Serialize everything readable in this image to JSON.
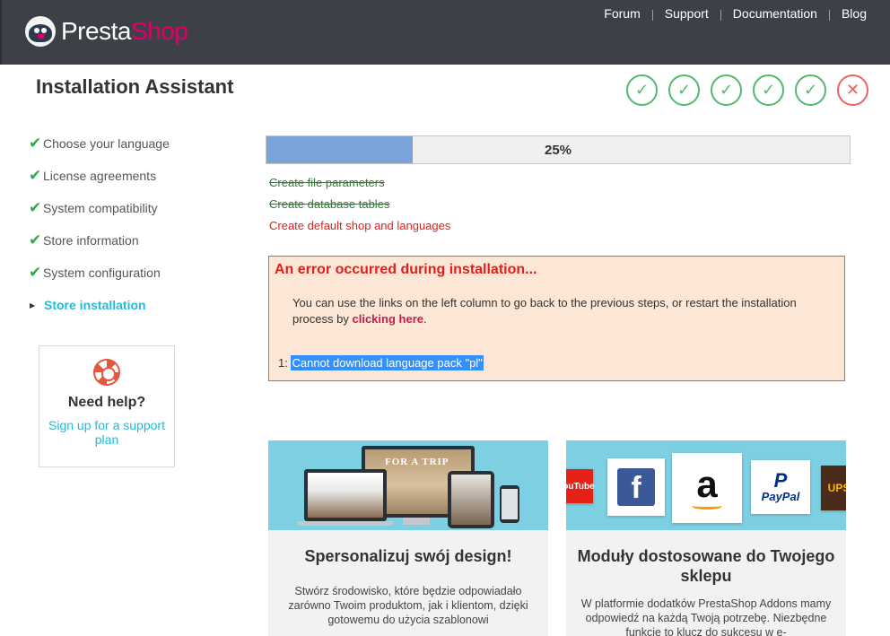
{
  "header": {
    "logo_presta": "Presta",
    "logo_shop": "Shop",
    "nav": [
      "Forum",
      "Support",
      "Documentation",
      "Blog"
    ]
  },
  "title": "Installation Assistant",
  "steps_status": [
    "done",
    "done",
    "done",
    "done",
    "done",
    "error"
  ],
  "sidebar": {
    "items": [
      {
        "label": "Choose your language",
        "state": "done"
      },
      {
        "label": "License agreements",
        "state": "done"
      },
      {
        "label": "System compatibility",
        "state": "done"
      },
      {
        "label": "Store information",
        "state": "done"
      },
      {
        "label": "System configuration",
        "state": "done"
      },
      {
        "label": "Store installation",
        "state": "active"
      }
    ]
  },
  "help": {
    "title": "Need help?",
    "link": "Sign up for a support plan"
  },
  "progress": {
    "percent": 25,
    "label": "25%"
  },
  "tasks": [
    {
      "label": "Create file parameters",
      "state": "done"
    },
    {
      "label": "Create database tables",
      "state": "done"
    },
    {
      "label": "Create default shop and languages",
      "state": "failed"
    }
  ],
  "error": {
    "title": "An error occurred during installation...",
    "message_before": "You can use the links on the left column to go back to the previous steps, or restart the installation process by",
    "link": "clicking here",
    "message_after": ".",
    "items": [
      {
        "number": "1:",
        "text": "Cannot download language pack \"pl\""
      }
    ]
  },
  "cards": [
    {
      "image_text": "FOR A TRIP",
      "title": "Spersonalizuj swój design!",
      "text": "Stwórz środowisko, które będzie odpowiadało zarówno Twoim produktom, jak i klientom, dzięki gotowemu do użycia szablonowi"
    },
    {
      "brands": [
        "YouTube",
        "Facebook",
        "Amazon",
        "PayPal",
        "UPS"
      ],
      "title": "Moduły dostosowane do Twojego sklepu",
      "text": "W platformie dodatków PrestaShop Addons mamy odpowiedź na każdą Twoją potrzebę. Niezbędne funkcje to klucz do sukcesu w e-"
    }
  ],
  "colors": {
    "header_bg": "#3d4047",
    "brand_pink": "#df0067",
    "success": "#4fba6f",
    "error": "#e0201c",
    "link": "#25b9d7",
    "progress_fill": "#7aa3d9",
    "error_bg": "#fce6d5"
  }
}
